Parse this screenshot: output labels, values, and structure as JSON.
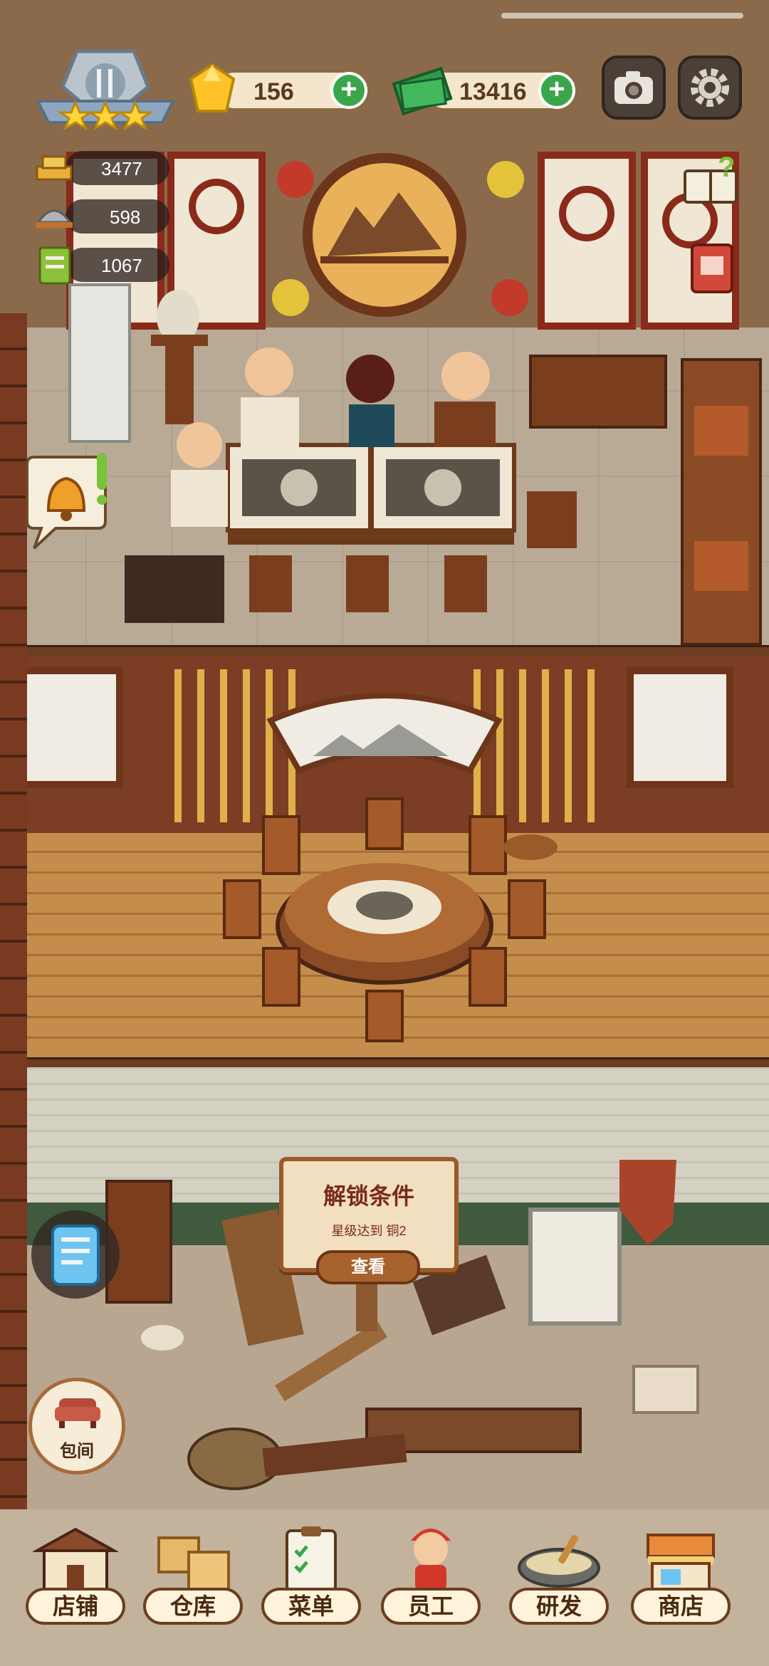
{
  "hud": {
    "gems": "156",
    "cash": "13416",
    "plus": "+"
  },
  "stats": [
    {
      "icon": "tip-tray-icon",
      "value": "3477"
    },
    {
      "icon": "dish-cover-icon",
      "value": "598"
    },
    {
      "icon": "recipe-book-icon",
      "value": "1067"
    }
  ],
  "unlock": {
    "title": "解锁条件",
    "condition": "星级达到    铜2",
    "button": "查看"
  },
  "private_room": {
    "label": "包间"
  },
  "nav": [
    {
      "label": "店铺",
      "icon": "shop-building-icon"
    },
    {
      "label": "仓库",
      "icon": "warehouse-boxes-icon"
    },
    {
      "label": "菜单",
      "icon": "menu-clipboard-icon"
    },
    {
      "label": "员工",
      "icon": "staff-person-icon"
    },
    {
      "label": "研发",
      "icon": "cooking-wok-icon"
    },
    {
      "label": "商店",
      "icon": "store-stall-icon"
    }
  ],
  "colors": {
    "accent_green": "#3aa64b",
    "wood_brown": "#8b5a30",
    "label_text": "#4a2a10"
  }
}
